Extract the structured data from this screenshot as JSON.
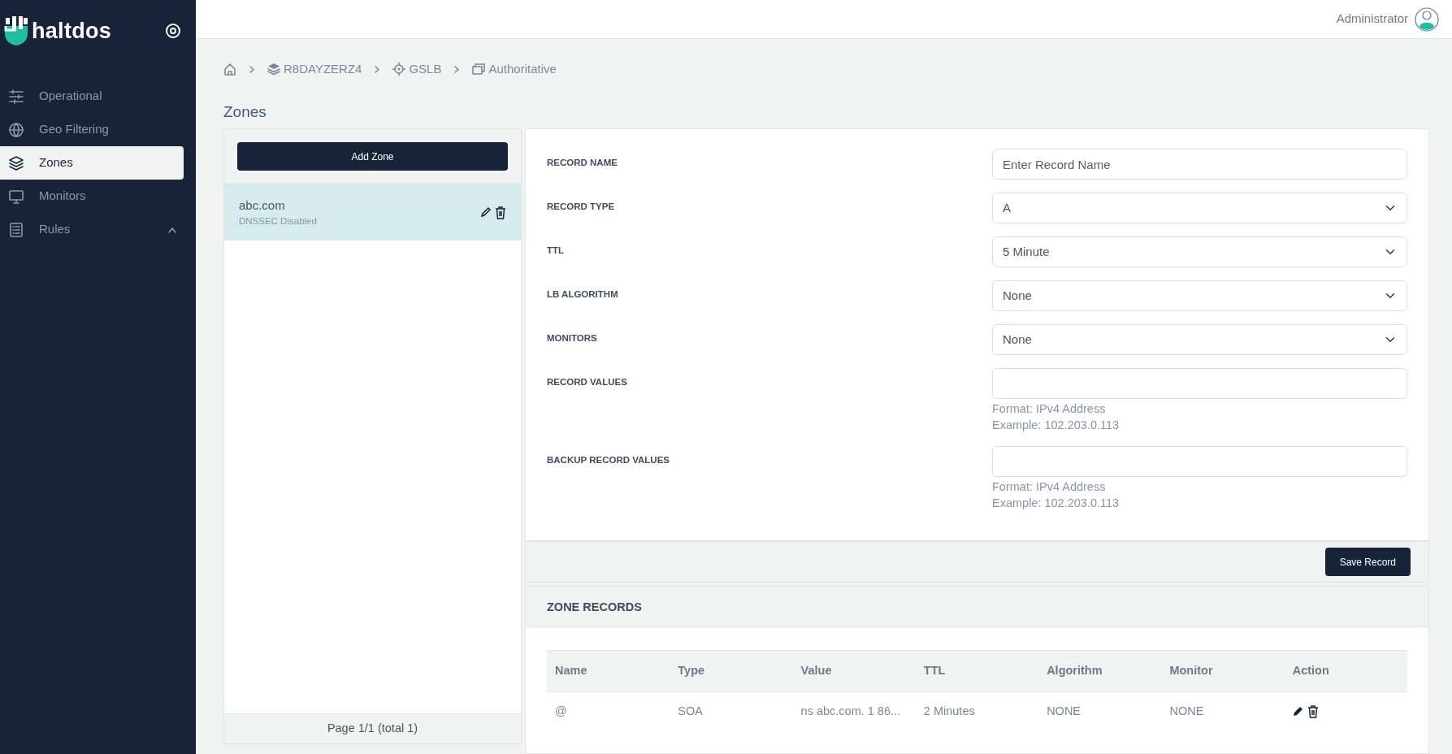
{
  "sidebar": {
    "logo": "haltdos",
    "items": [
      {
        "label": "Operational",
        "kind": "link",
        "selected": false
      },
      {
        "label": "Geo Filtering",
        "kind": "link",
        "selected": false
      },
      {
        "label": "Zones",
        "kind": "link",
        "selected": true
      },
      {
        "label": "Monitors",
        "kind": "link",
        "selected": false
      },
      {
        "label": "Rules",
        "kind": "group",
        "selected": false
      }
    ]
  },
  "header": {
    "user": "Administrator"
  },
  "breadcrumb": [
    "R8DAYZERZ4",
    "GSLB",
    "Authoritative"
  ],
  "page_title": "Zones",
  "zones_panel": {
    "add_button": "Add Zone",
    "zones": [
      {
        "name": "abc.com",
        "status": "DNSSEC Disabled",
        "selected": true
      }
    ],
    "pagination": "Page 1/1 (total 1)"
  },
  "record_form": {
    "fields": [
      {
        "label": "RECORD NAME",
        "kind": "text",
        "placeholder": "Enter Record Name"
      },
      {
        "label": "RECORD TYPE",
        "kind": "select",
        "value": "A"
      },
      {
        "label": "TTL",
        "kind": "select",
        "value": "5 Minute"
      },
      {
        "label": "LB ALGORITHM",
        "kind": "select",
        "value": "None"
      },
      {
        "label": "MONITORS",
        "kind": "select",
        "value": "None"
      },
      {
        "label": "RECORD VALUES",
        "kind": "text",
        "help": [
          "Format: IPv4 Address",
          "Example: 102.203.0.113"
        ]
      },
      {
        "label": "BACKUP RECORD VALUES",
        "kind": "text",
        "help": [
          "Format: IPv4 Address",
          "Example: 102.203.0.113"
        ]
      }
    ],
    "save_button": "Save Record"
  },
  "zone_records": {
    "title": "ZONE RECORDS",
    "columns": [
      "Name",
      "Type",
      "Value",
      "TTL",
      "Algorithm",
      "Monitor",
      "Action"
    ],
    "rows": [
      {
        "cells": [
          "@",
          "SOA",
          "ns abc.com. 1 86...",
          "2 Minutes",
          "NONE",
          "NONE"
        ]
      }
    ]
  }
}
